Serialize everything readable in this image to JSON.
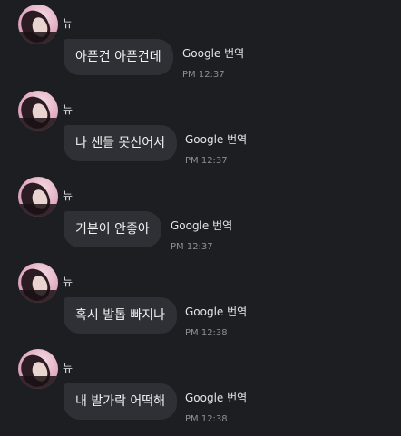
{
  "messages": [
    {
      "sender": "뉴",
      "text": "아픈건 아픈건데",
      "translate": "Google 번역",
      "time": "PM 12:37"
    },
    {
      "sender": "뉴",
      "text": "나 샌들 못신어서",
      "translate": "Google 번역",
      "time": "PM 12:37"
    },
    {
      "sender": "뉴",
      "text": "기분이 안좋아",
      "translate": "Google 번역",
      "time": "PM 12:37"
    },
    {
      "sender": "뉴",
      "text": "혹시 발톱 빠지나",
      "translate": "Google 번역",
      "time": "PM 12:38"
    },
    {
      "sender": "뉴",
      "text": "내 발가락 어떡해",
      "translate": "Google 번역",
      "time": "PM 12:38"
    }
  ],
  "colors": {
    "background": "#1d1e22",
    "bubble": "#2f3035",
    "timestamp": "#8d8e95",
    "avatar_bg": "#e4b0c3"
  },
  "icons": {
    "avatar": "profile-photo-pink-bg"
  }
}
